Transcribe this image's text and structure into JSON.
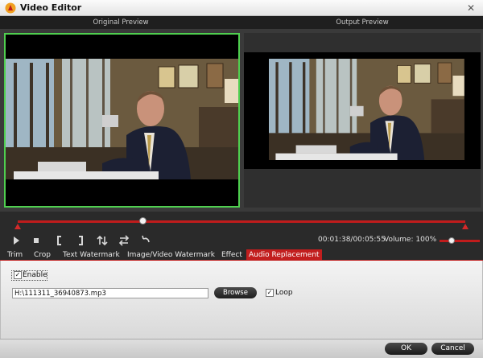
{
  "window": {
    "title": "Video Editor",
    "close_symbol": "✕"
  },
  "preview": {
    "original_label": "Original Preview",
    "output_label": "Output Preview"
  },
  "playback": {
    "position_fraction": 0.28,
    "time": "00:01:38/00:05:55",
    "volume_label": "Volume:",
    "volume_value": "100%",
    "volume_fraction": 0.3
  },
  "tabs": [
    {
      "label": "Trim"
    },
    {
      "label": "Crop"
    },
    {
      "label": "Text Watermark"
    },
    {
      "label": "Image/Video Watermark"
    },
    {
      "label": "Effect"
    },
    {
      "label": "Audio Replacement"
    }
  ],
  "audio": {
    "enable_label": "Enable",
    "enable_checked": true,
    "file_path": "H:\\111311_36940873.mp3",
    "browse_label": "Browse",
    "loop_label": "Loop",
    "loop_checked": true
  },
  "footer": {
    "ok_label": "OK",
    "cancel_label": "Cancel"
  },
  "colors": {
    "accent": "#c21e1e",
    "selection": "#4fcf4f"
  }
}
